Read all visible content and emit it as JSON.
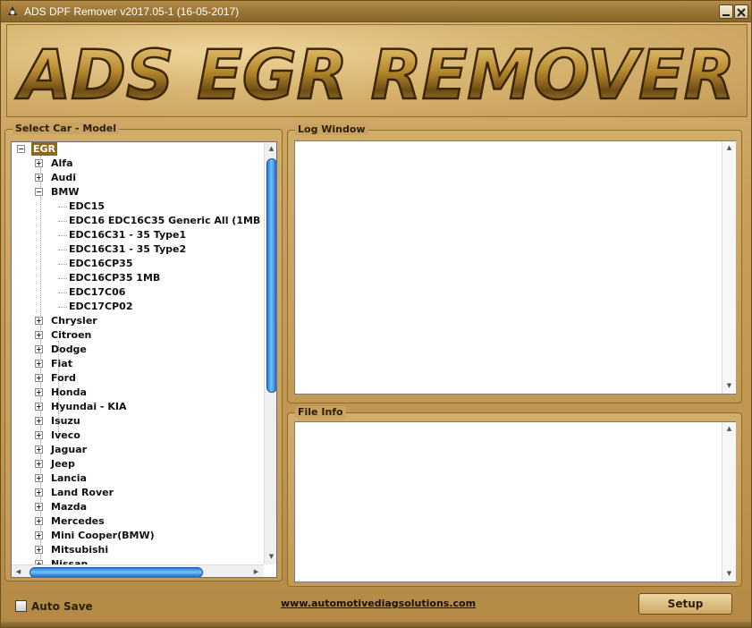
{
  "window": {
    "title": "ADS DPF Remover v2017.05-1 (16-05-2017)",
    "minimize_icon": "minimize-icon",
    "close_icon": "close-icon"
  },
  "banner": {
    "text": "ADS EGR REMOVER"
  },
  "car_panel": {
    "title": "Select Car - Model",
    "tree": {
      "root": "EGR",
      "brands_before": [
        "Alfa",
        "Audi"
      ],
      "expanded_brand": "BMW",
      "bmw_models": [
        "EDC15",
        "EDC16 EDC16C35 Generic All (1MB",
        "EDC16C31 - 35 Type1",
        "EDC16C31 - 35 Type2",
        "EDC16CP35",
        "EDC16CP35 1MB",
        "EDC17C06",
        "EDC17CP02"
      ],
      "brands_after": [
        "Chrysler",
        "Citroen",
        "Dodge",
        "Fiat",
        "Ford",
        "Honda",
        "Hyundai - KIA",
        "Isuzu",
        "Iveco",
        "Jaguar",
        "Jeep",
        "Lancia",
        "Land Rover",
        "Mazda",
        "Mercedes",
        "Mini Cooper(BMW)",
        "Mitsubishi",
        "Nissan"
      ]
    }
  },
  "log_panel": {
    "title": "Log Window",
    "content": ""
  },
  "file_panel": {
    "title": "File Info",
    "content": ""
  },
  "bottom": {
    "auto_save_label": "Auto Save",
    "auto_save_checked": false,
    "website": "www.automotivediagsolutions.com",
    "setup_label": "Setup"
  },
  "colors": {
    "window_gold": "#c8a05a",
    "scroll_thumb": "#3a8ee6",
    "root_highlight": "#8a6a1e"
  }
}
